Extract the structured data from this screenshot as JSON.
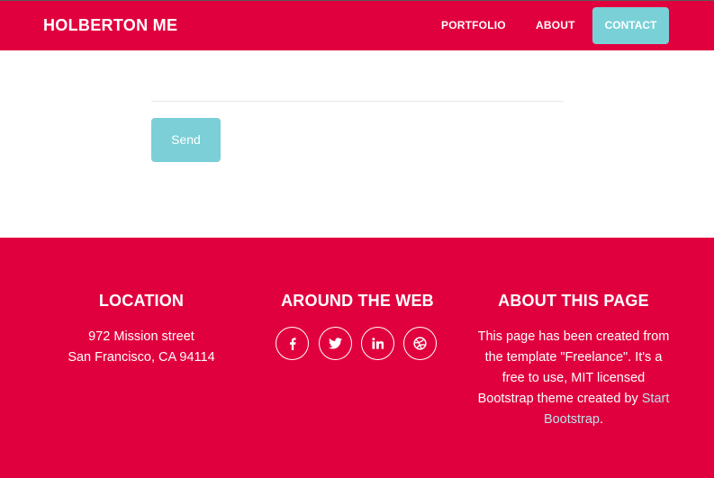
{
  "navbar": {
    "brand": "HOLBERTON ME",
    "links": [
      {
        "label": "PORTFOLIO"
      },
      {
        "label": "ABOUT"
      },
      {
        "label": "CONTACT"
      }
    ]
  },
  "form": {
    "send_label": "Send"
  },
  "footer": {
    "location": {
      "title": "LOCATION",
      "line1": "972 Mission street",
      "line2": "San Francisco, CA 94114"
    },
    "web": {
      "title": "AROUND THE WEB",
      "icons": [
        "facebook-icon",
        "twitter-icon",
        "linkedin-icon",
        "dribbble-icon"
      ]
    },
    "about": {
      "title": "ABOUT THIS PAGE",
      "text": "This page has been created from the template \"Freelance\". It's a free to use, MIT licensed Bootstrap theme created by",
      "link": "Start Bootstrap",
      "end": "."
    }
  },
  "colors": {
    "primary": "#e1003e",
    "accent": "#79d0d7",
    "link": "#b9e4ea"
  }
}
